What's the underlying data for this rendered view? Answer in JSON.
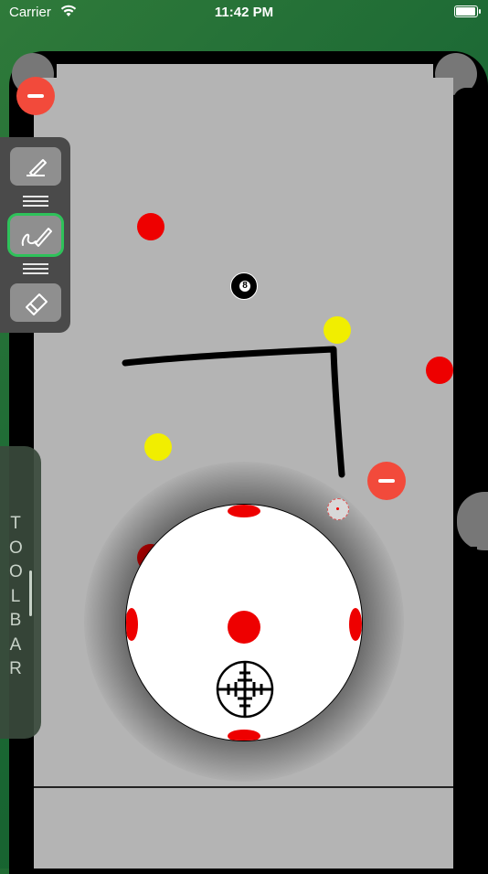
{
  "status_bar": {
    "carrier": "Carrier",
    "time": "11:42 PM"
  },
  "toolbar_tab": {
    "label": "TOOLBAR"
  },
  "eight_ball": {
    "number": "8"
  },
  "colors": {
    "cloth": "#b4b4b4",
    "rail": "#000000",
    "felt": "#1d6a35",
    "red_ball": "#ee0000",
    "yellow_ball": "#f1ee00",
    "minus_button": "#f24a3b"
  },
  "tools": [
    {
      "icon": "pencil-line-icon",
      "selected": false
    },
    {
      "icon": "pencil-freehand-icon",
      "selected": true
    },
    {
      "icon": "eraser-icon",
      "selected": false
    }
  ]
}
